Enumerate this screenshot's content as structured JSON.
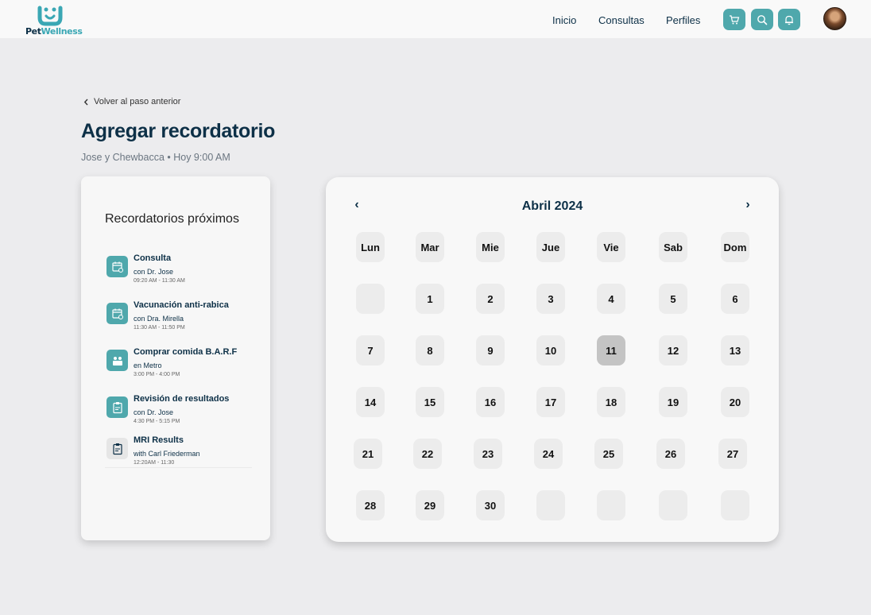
{
  "brand": {
    "name_part1": "Pet",
    "name_part2": "Wellness",
    "accent_color": "#3aa7b4",
    "button_color": "#4fa8ac"
  },
  "nav": {
    "links": [
      "Inicio",
      "Consultas",
      "Perfiles"
    ],
    "icons": [
      "cart-icon",
      "search-icon",
      "bell-icon"
    ]
  },
  "header": {
    "back_label": "Volver al paso anterior",
    "title": "Agregar recordatorio",
    "subtitle": "Jose y Chewbacca • Hoy 9:00 AM"
  },
  "reminders": {
    "title": "Recordatorios próximos",
    "items": [
      {
        "title": "Consulta",
        "with": "con Dr. Jose",
        "time": "09:20 AM - 11:30 AM",
        "icon": "calendar-icon"
      },
      {
        "title": "Vacunación anti-rabica",
        "with": "con Dra. Mirella",
        "time": "11:30 AM - 11:50 PM",
        "icon": "calendar-icon"
      },
      {
        "title": "Comprar comida B.A.R.F",
        "with": "en Metro",
        "time": "3:00 PM - 4:00 PM",
        "icon": "store-icon"
      },
      {
        "title": "Revisión de resultados",
        "with": "con Dr. Jose",
        "time": "4:30 PM - 5:15 PM",
        "icon": "clipboard-icon"
      },
      {
        "title": "MRI Results",
        "with": "with Carl Friederman",
        "time": "12:20AM - 11:30",
        "icon": "clipboard-icon"
      }
    ]
  },
  "calendar": {
    "month_label": "Abril 2024",
    "prev_label": "‹",
    "next_label": "›",
    "weekdays": [
      "Lun",
      "Mar",
      "Mie",
      "Jue",
      "Vie",
      "Sab",
      "Dom"
    ],
    "weeks": [
      [
        "",
        "1",
        "2",
        "3",
        "4",
        "5",
        "6"
      ],
      [
        "7",
        "8",
        "9",
        "10",
        "11",
        "12",
        "13"
      ],
      [
        "14",
        "15",
        "16",
        "17",
        "18",
        "19",
        "20"
      ],
      [
        "21",
        "22",
        "23",
        "24",
        "25",
        "26",
        "27"
      ],
      [
        "28",
        "29",
        "30",
        "",
        "",
        "",
        ""
      ]
    ],
    "selected_day": "11"
  }
}
